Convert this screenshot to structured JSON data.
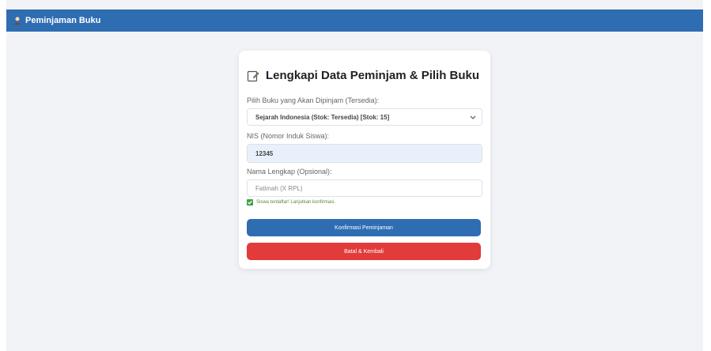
{
  "header": {
    "title": "Peminjaman Buku",
    "icon": "user-icon"
  },
  "form": {
    "title": "Lengkapi Data Peminjam & Pilih Buku",
    "title_icon": "note-edit-icon",
    "book_label": "Pilih Buku yang Akan Dipinjam (Tersedia):",
    "book_selected": "Sejarah Indonesia (Stok: Tersedia) [Stok: 15]",
    "nis_label": "NIS (Nomor Induk Siswa):",
    "nis_value": "12345",
    "name_label": "Nama Lengkap (Opsional):",
    "name_value": "Fatimah (X RPL)",
    "verified_text": "Siswa terdaftar! Lanjutkan konfirmasi.",
    "confirm_label": "Konfirmasi Peminjaman",
    "cancel_label": "Batal & Kembali"
  },
  "colors": {
    "primary": "#2f6db3",
    "danger": "#e23b3b",
    "success": "#43a047"
  }
}
